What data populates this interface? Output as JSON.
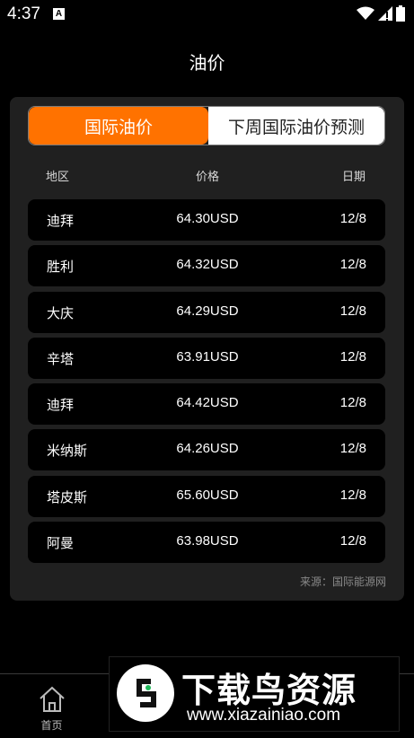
{
  "status_bar": {
    "time": "4:37",
    "app_icon_letter": "A",
    "icons": [
      "wifi-icon",
      "signal-icon",
      "battery-icon"
    ]
  },
  "page": {
    "title": "油价"
  },
  "tabs": {
    "active": "国际油价",
    "inactive": "下周国际油价预测"
  },
  "table": {
    "headers": {
      "region": "地区",
      "price": "价格",
      "date": "日期"
    },
    "rows": [
      {
        "region": "迪拜",
        "price": "64.30USD",
        "date": "12/8"
      },
      {
        "region": "胜利",
        "price": "64.32USD",
        "date": "12/8"
      },
      {
        "region": "大庆",
        "price": "64.29USD",
        "date": "12/8"
      },
      {
        "region": "辛塔",
        "price": "63.91USD",
        "date": "12/8"
      },
      {
        "region": "迪拜",
        "price": "64.42USD",
        "date": "12/8"
      },
      {
        "region": "米纳斯",
        "price": "64.26USD",
        "date": "12/8"
      },
      {
        "region": "塔皮斯",
        "price": "65.60USD",
        "date": "12/8"
      },
      {
        "region": "阿曼",
        "price": "63.98USD",
        "date": "12/8"
      }
    ]
  },
  "source": "来源：国际能源网",
  "bottom_nav": {
    "home_label": "首页",
    "home_icon": "home-icon"
  },
  "watermark": {
    "title": "下载鸟资源",
    "url": "www.xiazainiao.com"
  },
  "colors": {
    "accent": "#ff7200",
    "background": "#000000",
    "card": "#202020"
  }
}
